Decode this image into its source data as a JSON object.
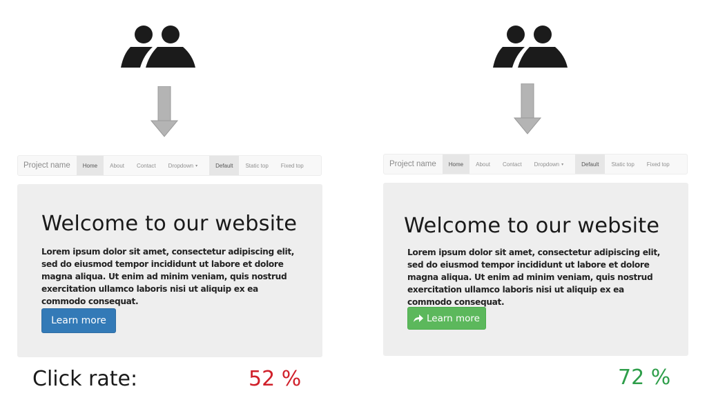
{
  "comparison": {
    "label": "Click rate:",
    "variants": [
      {
        "id": "A",
        "navbar": {
          "brand": "Project name",
          "items": [
            {
              "label": "Home",
              "active": true
            },
            {
              "label": "About",
              "active": false
            },
            {
              "label": "Contact",
              "active": false
            },
            {
              "label": "Dropdown",
              "active": false,
              "has_caret": true
            }
          ],
          "right_items": [
            {
              "label": "Default",
              "active": true
            },
            {
              "label": "Static top",
              "active": false
            },
            {
              "label": "Fixed top",
              "active": false
            }
          ]
        },
        "jumbotron": {
          "heading": "Welcome to our website",
          "body": "Lorem ipsum dolor sit amet, consectetur adipiscing elit, sed do eiusmod tempor incididunt ut labore et dolore magna aliqua. Ut enim ad minim veniam, quis nostrud exercitation ullamco laboris nisi ut aliquip ex ea commodo consequat.",
          "button": {
            "label": "Learn more",
            "color": "#337ab7",
            "icon": null
          }
        },
        "click_rate": "52 %",
        "click_rate_color": "#d0202a"
      },
      {
        "id": "B",
        "navbar": {
          "brand": "Project name",
          "items": [
            {
              "label": "Home",
              "active": true
            },
            {
              "label": "About",
              "active": false
            },
            {
              "label": "Contact",
              "active": false
            },
            {
              "label": "Dropdown",
              "active": false,
              "has_caret": true
            }
          ],
          "right_items": [
            {
              "label": "Default",
              "active": true
            },
            {
              "label": "Static top",
              "active": false
            },
            {
              "label": "Fixed top",
              "active": false
            }
          ]
        },
        "jumbotron": {
          "heading": "Welcome to our website",
          "body": "Lorem ipsum dolor sit amet, consectetur adipiscing elit, sed do eiusmod tempor incididunt ut labore et dolore magna aliqua. Ut enim ad minim veniam, quis nostrud exercitation ullamco laboris nisi ut aliquip ex ea commodo consequat.",
          "button": {
            "label": "Learn more",
            "color": "#5cb85c",
            "icon": "share-arrow-icon"
          }
        },
        "click_rate": "72 %",
        "click_rate_color": "#2e9e4a"
      }
    ]
  },
  "icons": {
    "audience": "users-icon",
    "flow": "arrow-down-icon",
    "caret": "▾"
  }
}
